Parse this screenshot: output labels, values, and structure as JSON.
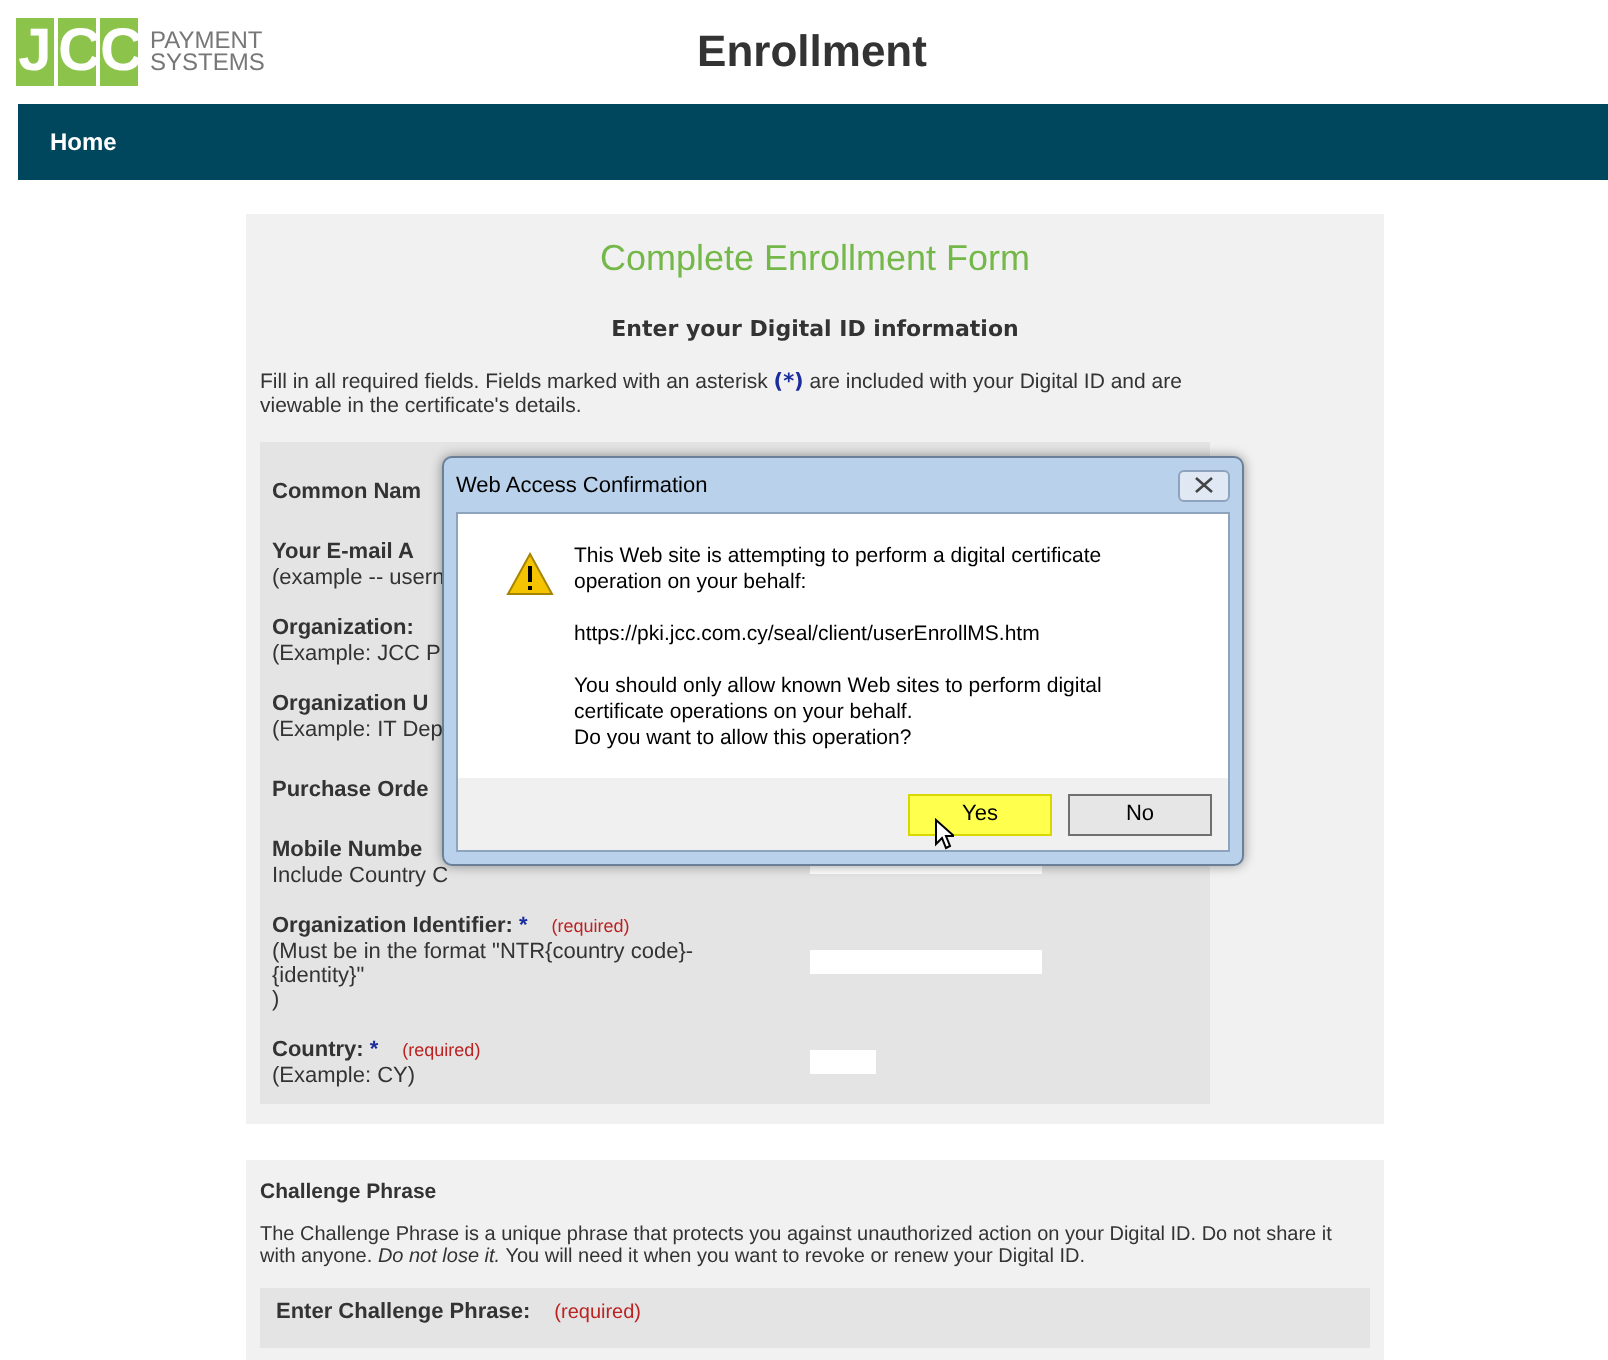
{
  "header": {
    "logo": {
      "mark": [
        "J",
        "C",
        "C"
      ],
      "lines": [
        "PAYMENT",
        "SYSTEMS"
      ]
    },
    "title": "Enrollment"
  },
  "nav": [
    {
      "label": "Home",
      "selected": true
    }
  ],
  "form": {
    "heading": "Complete Enrollment Form",
    "subheading": "Enter your Digital ID information",
    "intro": {
      "before": "Fill in all required fields. Fields marked with an asterisk ",
      "mark": "(*)",
      "after": " are included with your Digital ID and are viewable in the certificate's details."
    },
    "fields": [
      {
        "label": "Common Nam",
        "kind": "none"
      },
      {
        "label": "Your E-mail A",
        "hints": [
          "(example -- usern"
        ],
        "kind": "none"
      },
      {
        "label": "Organization:",
        "hints": [
          "(Example: JCC P"
        ],
        "kind": "none"
      },
      {
        "label": "Organization U",
        "hints": [
          "(Example: IT Dep"
        ],
        "kind": "none"
      },
      {
        "label": "Purchase Orde",
        "kind": "none"
      },
      {
        "label": "Mobile Numbe",
        "hints": [
          "Include Country C"
        ],
        "kind": "wide"
      },
      {
        "label": "Organization Identifier:",
        "star": "*",
        "required": "(required)",
        "hints": [
          "(Must be in the format \"NTR{country code}-",
          "{identity}\"",
          ")"
        ],
        "kind": "wide"
      },
      {
        "label": "Country:",
        "star": "*",
        "required": "(required)",
        "hints": [
          "(Example: CY)"
        ],
        "kind": "short"
      }
    ]
  },
  "dialog": {
    "title": "Web Access Confirmation",
    "message": "This Web site is attempting to perform a digital certificate operation on your behalf:",
    "url": "https://pki.jcc.com.cy/seal/client/userEnrollMS.htm",
    "warning": [
      "You should only allow known Web sites to perform digital certificate operations on your behalf.",
      "Do you want to allow this operation?"
    ],
    "buttons": [
      {
        "label": "Yes",
        "selected": true
      },
      {
        "label": "No",
        "selected": false
      }
    ]
  },
  "challenge": {
    "title": "Challenge Phrase",
    "text": "The Challenge Phrase is a unique phrase that protects you against unauthorized action on your Digital ID. Do not share it with anyone. *Do not lose it.* You will need it when you want to revoke or renew your Digital ID.",
    "field_label": "Enter Challenge Phrase:",
    "required": "(required)"
  }
}
